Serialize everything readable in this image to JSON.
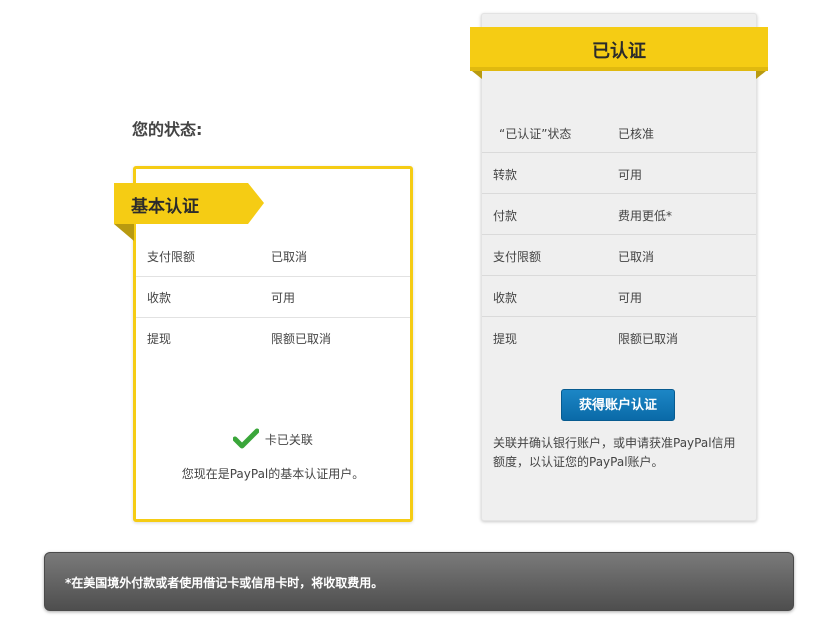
{
  "status_title": "您的状态:",
  "basic": {
    "ribbon_label": "基本认证",
    "rows": [
      {
        "key": "支付限额",
        "value": "已取消"
      },
      {
        "key": "收款",
        "value": "可用"
      },
      {
        "key": "提现",
        "value": "限额已取消"
      }
    ],
    "card_linked": "卡已关联",
    "note": "您现在是PayPal的基本认证用户。",
    "icon": "check-icon"
  },
  "verified": {
    "ribbon_label": "已认证",
    "rows": [
      {
        "key": "“已认证”状态",
        "value": "已核准"
      },
      {
        "key": "转款",
        "value": "可用"
      },
      {
        "key": "付款",
        "value": "费用更低*"
      },
      {
        "key": "支付限额",
        "value": "已取消"
      },
      {
        "key": "收款",
        "value": "可用"
      },
      {
        "key": "提现",
        "value": "限额已取消"
      }
    ],
    "button_label": "获得账户认证",
    "note": "关联并确认银行账户，或申请获准PayPal信用额度，以认证您的PayPal账户。"
  },
  "footer_note": "*在美国境外付款或者使用借记卡或信用卡时，将收取费用。",
  "colors": {
    "accent_yellow": "#f5cc14",
    "ribbon_fold": "#b89a10",
    "button_blue": "#0f76b8",
    "verified_bg": "#efefef",
    "footer_bg": "#5e5e5e",
    "check_green": "#3aa63a"
  }
}
